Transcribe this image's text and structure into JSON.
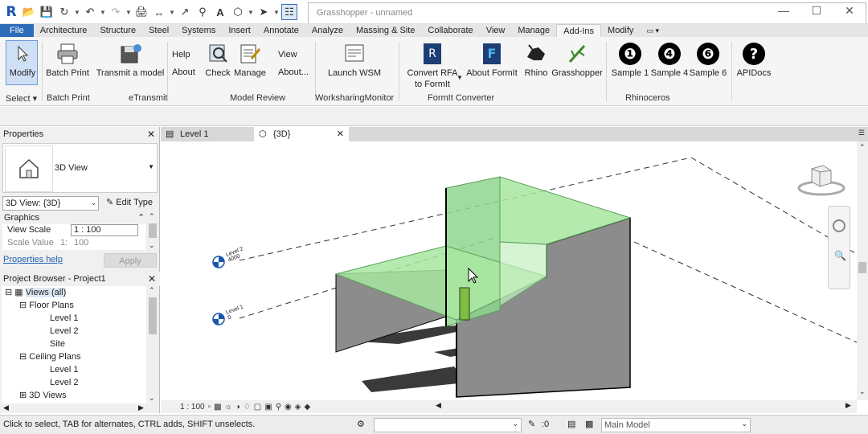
{
  "qat": {
    "logo": "R",
    "icons": [
      "open-icon",
      "save-icon",
      "sync-icon",
      "undo-icon",
      "redo-icon",
      "print-icon",
      "measure-icon",
      "dimension-icon",
      "tag-icon",
      "text-icon",
      "3d-view-icon",
      "section-icon",
      "switch-windows-icon"
    ]
  },
  "title": {
    "text": "Grasshopper - unnamed"
  },
  "tabs": [
    {
      "label": "File"
    },
    {
      "label": "Architecture"
    },
    {
      "label": "Structure"
    },
    {
      "label": "Steel"
    },
    {
      "label": "Systems"
    },
    {
      "label": "Insert"
    },
    {
      "label": "Annotate"
    },
    {
      "label": "Analyze"
    },
    {
      "label": "Massing & Site"
    },
    {
      "label": "Collaborate"
    },
    {
      "label": "View"
    },
    {
      "label": "Manage"
    },
    {
      "label": "Add-Ins"
    },
    {
      "label": "Modify"
    }
  ],
  "ribbon": {
    "modify": "Modify",
    "batch_print": "Batch Print",
    "transmit": "Transmit a model",
    "help": "Help",
    "about": "About",
    "check": "Check",
    "manage": "Manage",
    "view": "View",
    "about_view": "About...",
    "launch_wsm": "Launch WSM",
    "convert_rfa_1": "Convert RFA",
    "convert_rfa_2": "to FormIt",
    "about_formit": "About FormIt",
    "rhino": "Rhino",
    "grasshopper": "Grasshopper",
    "sample1": "Sample 1",
    "sample4": "Sample 4",
    "sample6": "Sample 6",
    "apidocs": "APIDocs",
    "sample1_num": "❶",
    "sample4_num": "❹",
    "sample6_num": "❻",
    "apidocs_sym": "?",
    "panels": {
      "select": "Select",
      "batch_print": "Batch Print",
      "etransmit": "eTransmit",
      "model_review": "Model Review",
      "wsm": "WorksharingMonitor",
      "formit": "FormIt Converter",
      "rhinoceros": "Rhinoceros"
    }
  },
  "properties": {
    "title": "Properties",
    "type_name": "3D View",
    "selector": "3D View: {3D}",
    "edit_type": "Edit Type",
    "section": "Graphics",
    "view_scale_label": "View Scale",
    "view_scale_value": "1 : 100",
    "scale_value_label": "Scale Value",
    "scale_value_prefix": "1:",
    "scale_value": "100",
    "help_link": "Properties help",
    "apply": "Apply"
  },
  "browser": {
    "title": "Project Browser - Project1",
    "items": [
      {
        "label": "Views (all)"
      },
      {
        "label": "Floor Plans"
      },
      {
        "label": "Level 1"
      },
      {
        "label": "Level 2"
      },
      {
        "label": "Site"
      },
      {
        "label": "Ceiling Plans"
      },
      {
        "label": "Level 1"
      },
      {
        "label": "Level 2"
      },
      {
        "label": "3D Views"
      }
    ]
  },
  "view_tabs": [
    {
      "label": "Level 1"
    },
    {
      "label": "{3D}"
    }
  ],
  "levels": [
    {
      "name": "Level 2",
      "elevation": "4000"
    },
    {
      "name": "Level 1",
      "elevation": "0"
    }
  ],
  "view_control": {
    "scale": "1 : 100"
  },
  "status": {
    "hint": "Click to select, TAB for alternates, CTRL adds, SHIFT unselects.",
    "filter_count": ":0",
    "model": "Main Model"
  },
  "colors": {
    "accent": "#2c6cb8",
    "glass": "#8fd68f",
    "wall": "#8c8c8c"
  }
}
